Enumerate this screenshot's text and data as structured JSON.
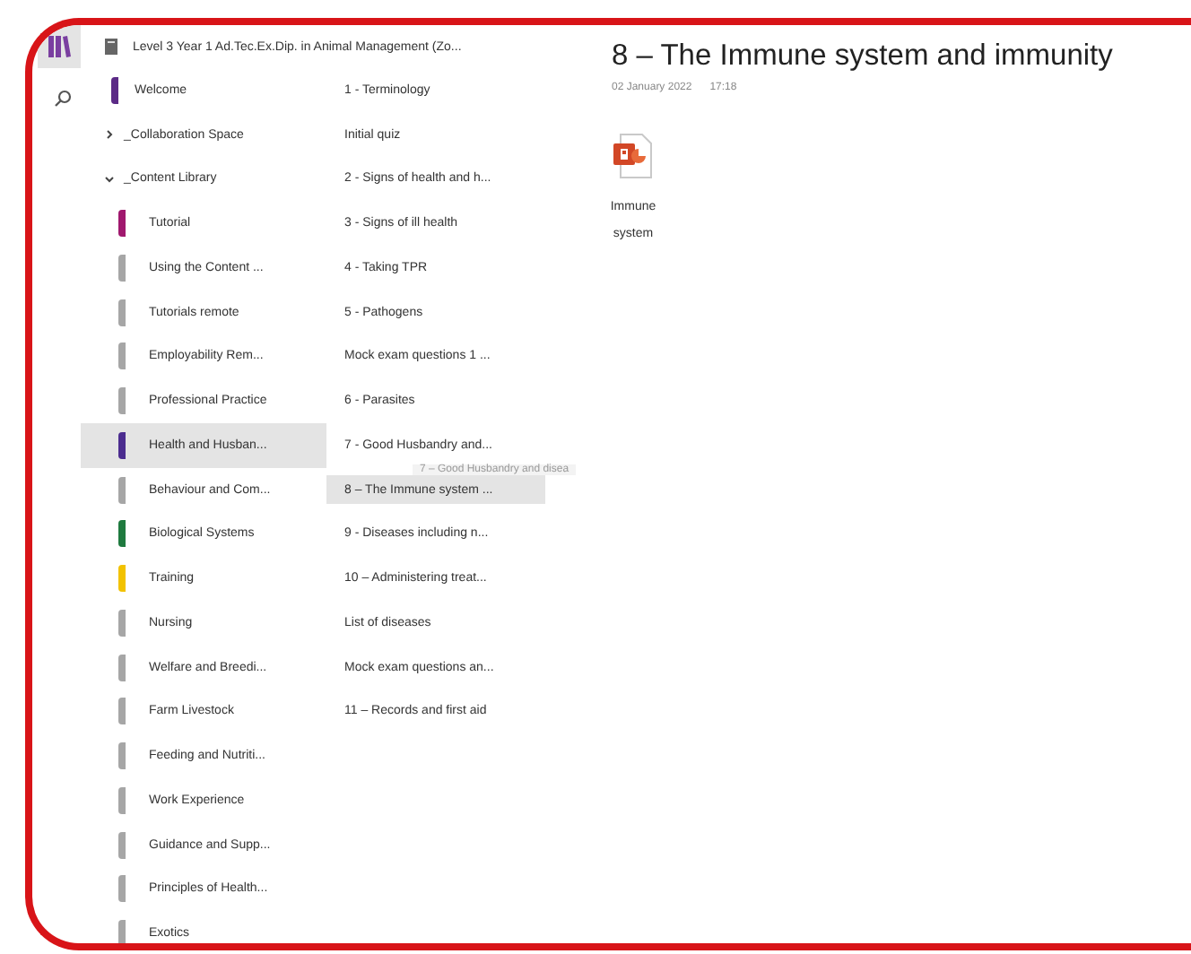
{
  "notebook": {
    "title": "Level 3 Year 1 Ad.Tec.Ex.Dip. in Animal Management (Zo..."
  },
  "sections": [
    {
      "kind": "section",
      "name": "Welcome",
      "color": "#5b2a86",
      "selected": false
    },
    {
      "kind": "group",
      "name": "_Collaboration Space",
      "expanded": false
    },
    {
      "kind": "group",
      "name": "_Content Library",
      "expanded": true,
      "children": [
        {
          "kind": "section",
          "name": "Tutorial",
          "color": "#a0186e",
          "selected": false
        },
        {
          "kind": "section",
          "name": "Using the Content ...",
          "color": "#a6a6a6",
          "selected": false
        },
        {
          "kind": "section",
          "name": "Tutorials remote",
          "color": "#a6a6a6",
          "selected": false
        },
        {
          "kind": "section",
          "name": "Employability Rem...",
          "color": "#a6a6a6",
          "selected": false
        },
        {
          "kind": "section",
          "name": "Professional Practice",
          "color": "#a6a6a6",
          "selected": false
        },
        {
          "kind": "section",
          "name": "Health and Husban...",
          "color": "#4b2c8f",
          "selected": true
        },
        {
          "kind": "section",
          "name": "Behaviour and Com...",
          "color": "#a6a6a6",
          "selected": false
        },
        {
          "kind": "section",
          "name": "Biological Systems",
          "color": "#1f7a3f",
          "selected": false
        },
        {
          "kind": "section",
          "name": "Training",
          "color": "#f2c200",
          "selected": false
        },
        {
          "kind": "section",
          "name": "Nursing",
          "color": "#a6a6a6",
          "selected": false
        },
        {
          "kind": "section",
          "name": "Welfare and Breedi...",
          "color": "#a6a6a6",
          "selected": false
        },
        {
          "kind": "section",
          "name": "Farm Livestock",
          "color": "#a6a6a6",
          "selected": false
        },
        {
          "kind": "section",
          "name": "Feeding and Nutriti...",
          "color": "#a6a6a6",
          "selected": false
        },
        {
          "kind": "section",
          "name": "Work Experience",
          "color": "#a6a6a6",
          "selected": false
        },
        {
          "kind": "section",
          "name": "Guidance and Supp...",
          "color": "#a6a6a6",
          "selected": false
        },
        {
          "kind": "section",
          "name": "Principles of Health...",
          "color": "#a6a6a6",
          "selected": false
        },
        {
          "kind": "section",
          "name": "Exotics",
          "color": "#a6a6a6",
          "selected": false
        }
      ]
    }
  ],
  "pages": [
    {
      "title": "1 - Terminology",
      "selected": false
    },
    {
      "title": "Initial quiz",
      "selected": false
    },
    {
      "title": "2 - Signs of health and h...",
      "selected": false
    },
    {
      "title": "3 - Signs of ill health",
      "selected": false
    },
    {
      "title": "4 - Taking TPR",
      "selected": false
    },
    {
      "title": "5 - Pathogens",
      "selected": false
    },
    {
      "title": "Mock exam questions 1 ...",
      "selected": false
    },
    {
      "title": "6 - Parasites",
      "selected": false
    },
    {
      "title": "7 - Good Husbandry and...",
      "selected": false
    },
    {
      "title": "8 – The Immune system ...",
      "selected": true
    },
    {
      "title": "9 - Diseases including n...",
      "selected": false
    },
    {
      "title": "10 – Administering treat...",
      "selected": false
    },
    {
      "title": "List of diseases",
      "selected": false
    },
    {
      "title": "Mock exam questions an...",
      "selected": false
    },
    {
      "title": "11 – Records and first aid",
      "selected": false
    }
  ],
  "drag_ghost": {
    "text": "7 – Good Husbandry and disea"
  },
  "page": {
    "title": "8 – The Immune system and immunity",
    "date": "02 January 2022",
    "time": "17:18",
    "attachments": [
      {
        "name": "Immune system"
      }
    ]
  }
}
